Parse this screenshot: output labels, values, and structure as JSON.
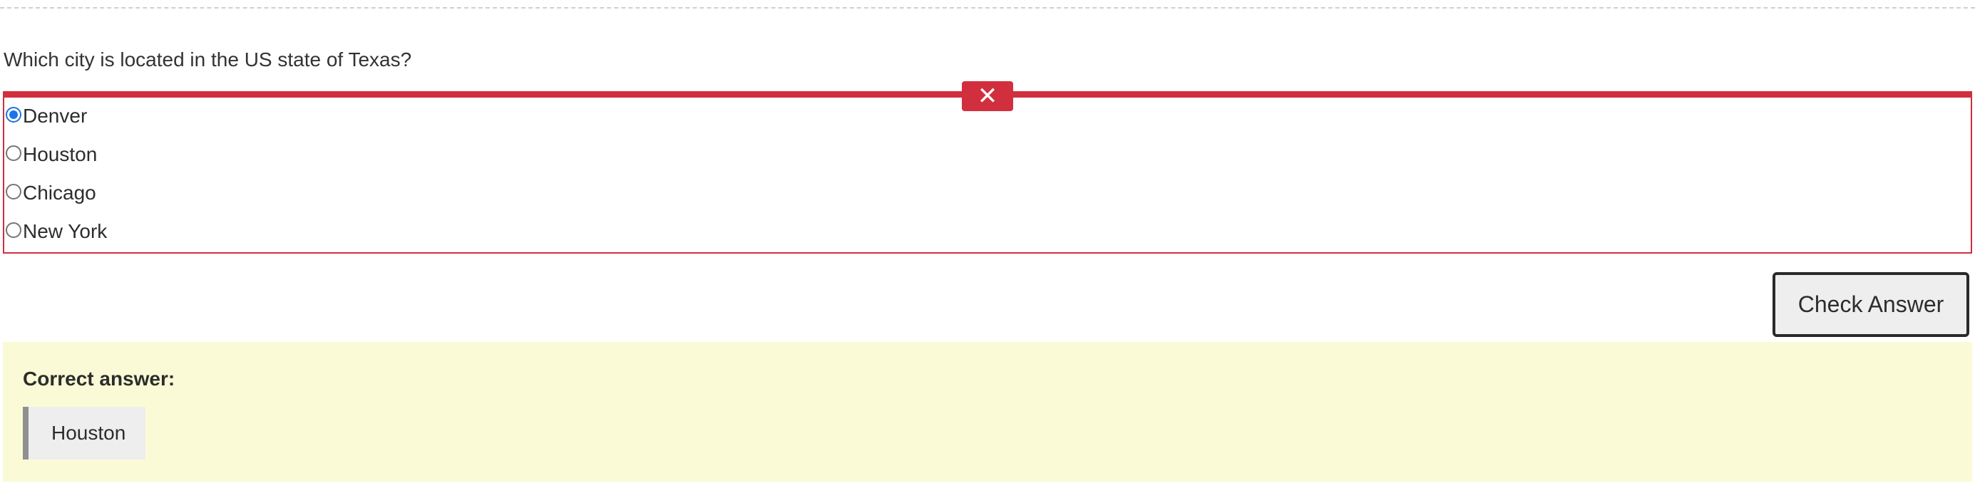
{
  "question": {
    "text": "Which city is located in the US state of Texas?"
  },
  "options": [
    {
      "label": "Denver",
      "selected": true
    },
    {
      "label": "Houston",
      "selected": false
    },
    {
      "label": "Chicago",
      "selected": false
    },
    {
      "label": "New York",
      "selected": false
    }
  ],
  "result": {
    "status": "incorrect",
    "status_icon": "close-icon",
    "status_symbol": "✕",
    "status_color": "#d12f3d"
  },
  "actions": {
    "check_label": "Check Answer"
  },
  "feedback": {
    "label": "Correct answer:",
    "answer": "Houston",
    "panel_color": "#fafad6"
  }
}
